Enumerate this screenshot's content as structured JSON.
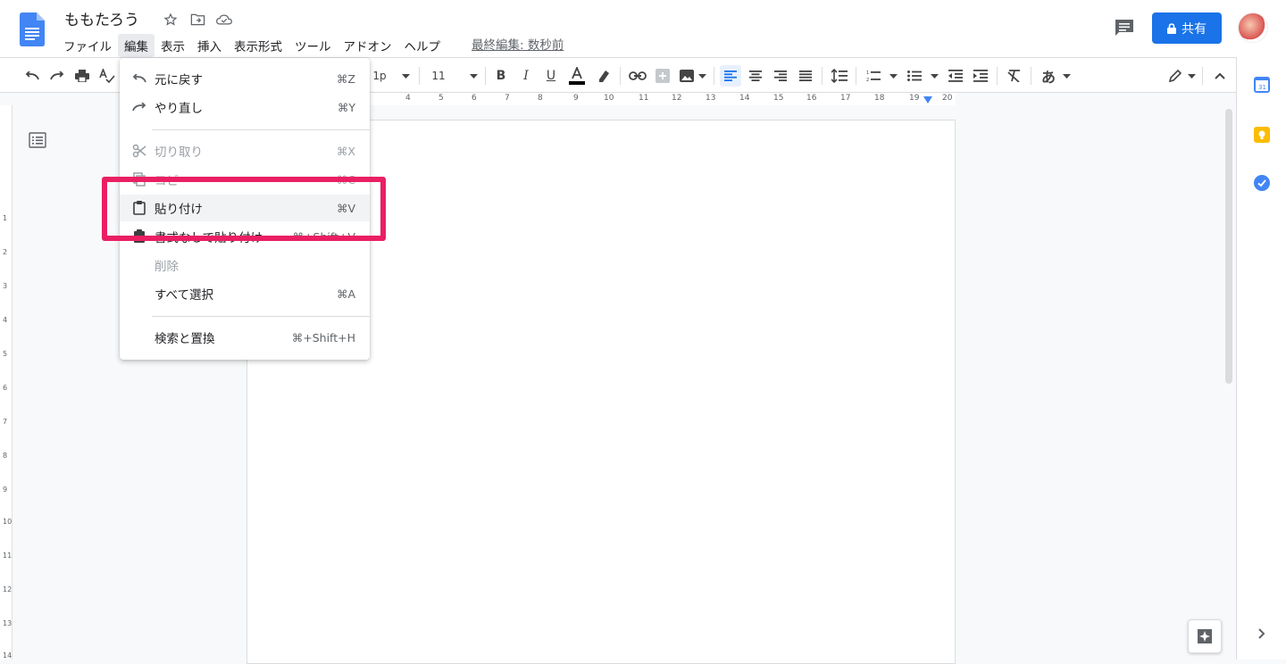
{
  "doc": {
    "title": "ももたろう",
    "last_edit": "最終編集: 数秒前"
  },
  "menubar": [
    "ファイル",
    "編集",
    "表示",
    "挿入",
    "表示形式",
    "ツール",
    "アドオン",
    "ヘルプ"
  ],
  "share_label": "共有",
  "toolbar": {
    "line_spacing": "1p",
    "font_size": "11",
    "input_tools": "あ"
  },
  "ruler": [
    "4",
    "5",
    "6",
    "7",
    "8",
    "9",
    "10",
    "11",
    "12",
    "13",
    "14",
    "15",
    "16",
    "17",
    "18",
    "19",
    "20"
  ],
  "vruler": [
    "1",
    "2",
    "3",
    "4",
    "5",
    "6",
    "7",
    "8",
    "9",
    "10",
    "11",
    "12",
    "13",
    "14"
  ],
  "edit_menu": {
    "items": [
      {
        "label": "元に戻す",
        "shortcut": "⌘Z",
        "disabled": false
      },
      {
        "label": "やり直し",
        "shortcut": "⌘Y",
        "disabled": false
      },
      {
        "label": "切り取り",
        "shortcut": "⌘X",
        "disabled": true
      },
      {
        "label": "コピー",
        "shortcut": "⌘C",
        "disabled": true
      },
      {
        "label": "貼り付け",
        "shortcut": "⌘V",
        "disabled": false
      },
      {
        "label": "書式なしで貼り付け",
        "shortcut": "⌘+Shift+V",
        "disabled": false
      },
      {
        "label": "削除",
        "shortcut": "",
        "disabled": true
      },
      {
        "label": "すべて選択",
        "shortcut": "⌘A",
        "disabled": false
      },
      {
        "label": "検索と置換",
        "shortcut": "⌘+Shift+H",
        "disabled": false
      }
    ]
  },
  "colors": {
    "accent": "#1a73e8",
    "highlight_box": "#ea1f63"
  }
}
